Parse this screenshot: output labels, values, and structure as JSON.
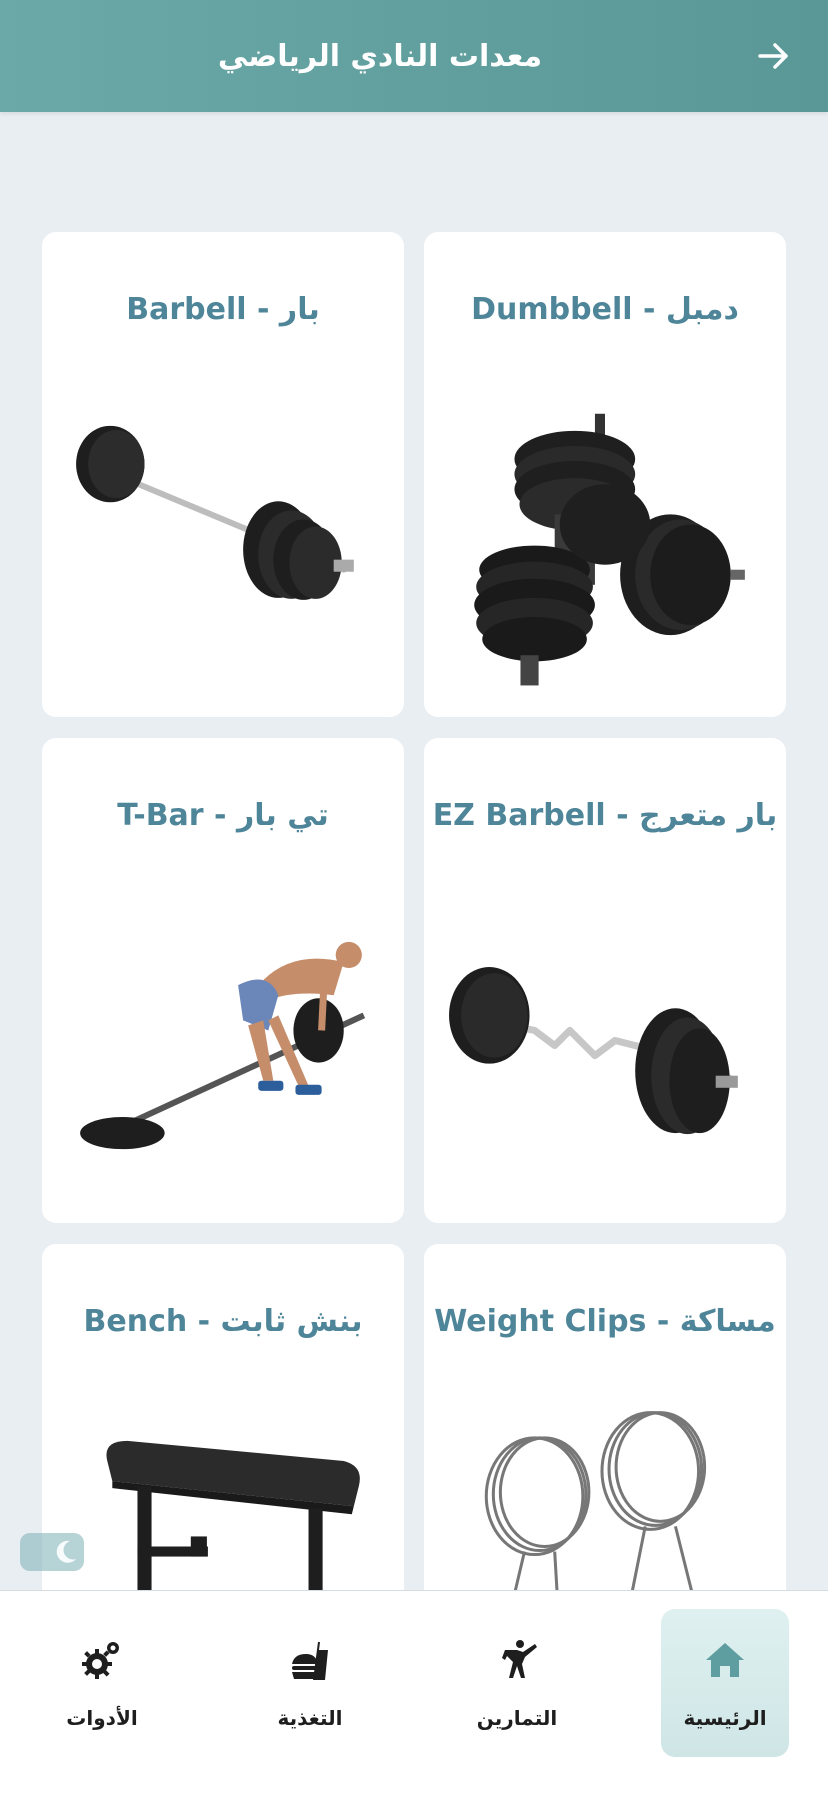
{
  "header": {
    "title": "معدات النادي الرياضي",
    "back_icon": "arrow-right-icon"
  },
  "equipment": [
    {
      "title": "دمبل - Dumbbell",
      "image": "dumbbell-image"
    },
    {
      "title": "بار - Barbell",
      "image": "barbell-image"
    },
    {
      "title": "بار متعرج - EZ Barbell",
      "image": "ez-barbell-image"
    },
    {
      "title": "تي بار - T-Bar",
      "image": "t-bar-row-image"
    },
    {
      "title": "مساكة - Weight Clips",
      "image": "weight-clips-image"
    },
    {
      "title": "بنش ثابت - Bench",
      "image": "bench-image"
    }
  ],
  "theme_toggle": {
    "icon": "moon-icon"
  },
  "bottom_nav": {
    "items": [
      {
        "label": "الرئيسية",
        "icon": "home-icon",
        "active": true
      },
      {
        "label": "التمارين",
        "icon": "martial-arts-icon",
        "active": false
      },
      {
        "label": "التغذية",
        "icon": "burger-drink-icon",
        "active": false
      },
      {
        "label": "الأدوات",
        "icon": "gear-tools-icon",
        "active": false
      }
    ]
  },
  "colors": {
    "header": "#5fa0a0",
    "card_title": "#4e8599",
    "background": "#e9eef3",
    "nav_active": "#d6ebeb"
  }
}
